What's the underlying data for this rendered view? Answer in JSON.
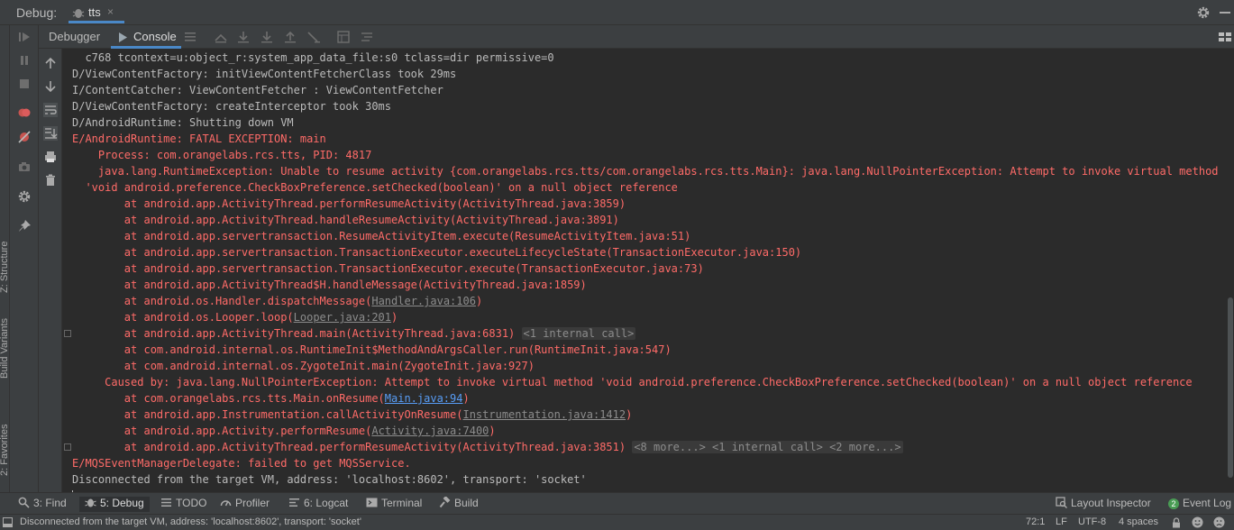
{
  "titlebar": {
    "title": "Debug:",
    "session_tab": "tts",
    "close_glyph": "×"
  },
  "tool_windows_left": [
    {
      "label": "Z: Structure"
    },
    {
      "label": "Build Variants"
    },
    {
      "label": "2: Favorites"
    }
  ],
  "debug_tabs": [
    {
      "label": "Debugger"
    },
    {
      "label": "Console"
    }
  ],
  "console": {
    "lines": [
      {
        "text": "  c768 tcontext=u:object_r:system_app_data_file:s0 tclass=dir permissive=0",
        "level": "info"
      },
      {
        "text": "D/ViewContentFactory: initViewContentFetcherClass took 29ms",
        "level": "info"
      },
      {
        "text": "I/ContentCatcher: ViewContentFetcher : ViewContentFetcher",
        "level": "info"
      },
      {
        "text": "D/ViewContentFactory: createInterceptor took 30ms",
        "level": "info"
      },
      {
        "text": "D/AndroidRuntime: Shutting down VM",
        "level": "info"
      },
      {
        "text": "E/AndroidRuntime: FATAL EXCEPTION: main",
        "level": "error"
      },
      {
        "text": "    Process: com.orangelabs.rcs.tts, PID: 4817",
        "level": "error"
      },
      {
        "text": "    java.lang.RuntimeException: Unable to resume activity {com.orangelabs.rcs.tts/com.orangelabs.rcs.tts.Main}: java.lang.NullPointerException: Attempt to invoke virtual method",
        "level": "error"
      },
      {
        "text": "  'void android.preference.CheckBoxPreference.setChecked(boolean)' on a null object reference",
        "level": "error"
      },
      {
        "text": "        at android.app.ActivityThread.performResumeActivity(ActivityThread.java:3859)",
        "level": "error"
      },
      {
        "text": "        at android.app.ActivityThread.handleResumeActivity(ActivityThread.java:3891)",
        "level": "error"
      },
      {
        "text": "        at android.app.servertransaction.ResumeActivityItem.execute(ResumeActivityItem.java:51)",
        "level": "error"
      },
      {
        "text": "        at android.app.servertransaction.TransactionExecutor.executeLifecycleState(TransactionExecutor.java:150)",
        "level": "error"
      },
      {
        "text": "        at android.app.servertransaction.TransactionExecutor.execute(TransactionExecutor.java:73)",
        "level": "error"
      },
      {
        "text": "        at android.app.ActivityThread$H.handleMessage(ActivityThread.java:1859)",
        "level": "error"
      },
      {
        "text": "        at android.os.Handler.dispatchMessage(",
        "level": "error",
        "link": "Handler.java:106",
        "after": ")"
      },
      {
        "text": "        at android.os.Looper.loop(",
        "level": "error",
        "link": "Looper.java:201",
        "after": ")"
      },
      {
        "text": "        at android.app.ActivityThread.main(ActivityThread.java:6831)",
        "level": "error",
        "fold": "<1 internal call>",
        "marker": true
      },
      {
        "text": "        at com.android.internal.os.RuntimeInit$MethodAndArgsCaller.run(RuntimeInit.java:547)",
        "level": "error"
      },
      {
        "text": "        at com.android.internal.os.ZygoteInit.main(ZygoteInit.java:927)",
        "level": "error"
      },
      {
        "text": "     Caused by: java.lang.NullPointerException: Attempt to invoke virtual method 'void android.preference.CheckBoxPreference.setChecked(boolean)' on a null object reference",
        "level": "error"
      },
      {
        "text": "        at com.orangelabs.rcs.tts.Main.onResume(",
        "level": "error",
        "link": "Main.java:94",
        "link_blue": true,
        "after": ")"
      },
      {
        "text": "        at android.app.Instrumentation.callActivityOnResume(",
        "level": "error",
        "link": "Instrumentation.java:1412",
        "after": ")"
      },
      {
        "text": "        at android.app.Activity.performResume(",
        "level": "error",
        "link": "Activity.java:7400",
        "after": ")"
      },
      {
        "text": "        at android.app.ActivityThread.performResumeActivity(ActivityThread.java:3851)",
        "level": "error",
        "fold": "<8 more...> <1 internal call> <2 more...>",
        "marker": true
      },
      {
        "text": "E/MQSEventManagerDelegate: failed to get MQSService.",
        "level": "error"
      },
      {
        "text": "Disconnected from the target VM, address: 'localhost:8602', transport: 'socket'",
        "level": "info"
      }
    ]
  },
  "bottom_tools": [
    {
      "label": "3: Find",
      "icon": "search-icon"
    },
    {
      "label": "5: Debug",
      "icon": "bug-icon",
      "active": true
    },
    {
      "label": "TODO",
      "icon": "list-icon"
    },
    {
      "label": "Profiler",
      "icon": "gauge-icon"
    },
    {
      "label": "6: Logcat",
      "icon": "logcat-icon"
    },
    {
      "label": "Terminal",
      "icon": "terminal-icon"
    },
    {
      "label": "Build",
      "icon": "hammer-icon"
    },
    {
      "label": "Layout Inspector",
      "icon": "inspector-icon"
    },
    {
      "label": "Event Log",
      "icon": "event-log-badge",
      "badge": "2"
    }
  ],
  "status": {
    "message": "Disconnected from the target VM, address: 'localhost:8602', transport: 'socket'",
    "position": "72:1",
    "line_sep": "LF",
    "encoding": "UTF-8",
    "indent": "4 spaces"
  },
  "colors": {
    "error": "#ff6b68",
    "info": "#bbbbbb",
    "accent": "#4a88c7",
    "panel": "#3c3f41",
    "editor": "#2b2b2b"
  }
}
